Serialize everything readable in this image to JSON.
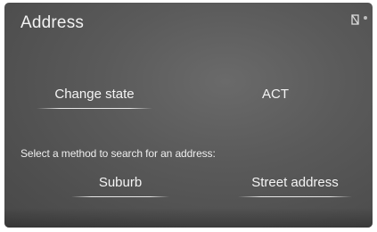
{
  "screen": {
    "title": "Address"
  },
  "state": {
    "change_label": "Change state",
    "value": "ACT"
  },
  "search": {
    "prompt": "Select a method to search for an address:",
    "options": [
      {
        "label": "Suburb"
      },
      {
        "label": "Street address"
      }
    ]
  },
  "icons": {
    "status": "signal-status-icon"
  },
  "colors": {
    "background": "#575757",
    "text": "#f4f4f4"
  }
}
